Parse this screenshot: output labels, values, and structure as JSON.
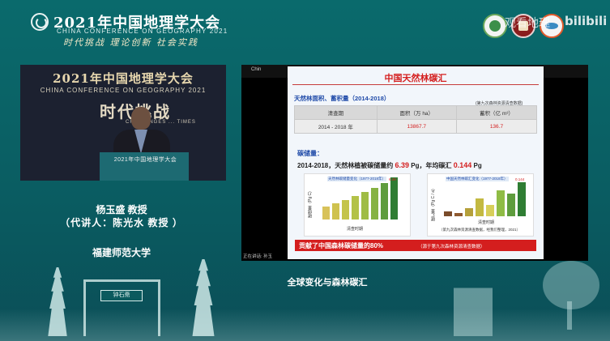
{
  "header": {
    "title": "2021年中国地理学大会",
    "subtitle": "CHINA CONFERENCE ON GEOGRAPHY 2021",
    "slogan": "时代挑战  理论创新  社会实践",
    "watermark": "观看地理",
    "platform": "bilibili"
  },
  "video": {
    "title": "2021年中国地理学大会",
    "subtitle": "CHINA CONFERENCE ON GEOGRAPHY 2021",
    "slogan": "时代挑战",
    "small_text": "CHALLENGES ... TIMES",
    "podium_text": "2021年中国地理学大会"
  },
  "speaker": {
    "name": "杨玉盛 教授",
    "substitute": "（代讲人：陈光水 教授 ）",
    "institution": "福建师范大学"
  },
  "slide": {
    "tag": "Chin",
    "title": "中国天然林碳汇",
    "section1": "天然林面积、蓄积量（2014-2018）",
    "source1": "(第九次森林资源清查数据)",
    "table": {
      "headers": [
        "清查期",
        "面积（万 ha）",
        "蓄积（亿 m³）"
      ],
      "row": [
        "2014 - 2018 年",
        "13867.7",
        "136.7"
      ]
    },
    "section2": "碳储量：",
    "statement_pre": "2014-2018，天然林植被碳储量约",
    "statement_val1": "6.39",
    "statement_mid": "Pg，年均碳汇",
    "statement_val2": "0.144",
    "statement_post": "Pg",
    "chart_left": {
      "title": "天然林碳储量变化（1977-2018年）",
      "ylabel": "碳储量（Pg C）",
      "xlabel": "清查时期",
      "top_label": "6.39"
    },
    "chart_right": {
      "title": "中国天然林碳汇变化（1977-2018年）",
      "ylabel": "碳汇量（Pg C / a）",
      "xlabel": "清查时期",
      "top_label": "0.144",
      "note": "（第九次森林资源清查数据，经我们整理，2021）"
    },
    "banner_main": "贡献了中国森林碳储量的80%",
    "banner_source": "（源于第九次森林资源清查数据）",
    "ticker": "正在讲话: 孙玉"
  },
  "footer": {
    "topic": "全球变化与森林碳汇",
    "arch_plaque": "钟石斋"
  },
  "colors": {
    "background": "#0b5a5e",
    "accent_red": "#d41e1e",
    "accent_blue": "#1f4aa8"
  }
}
